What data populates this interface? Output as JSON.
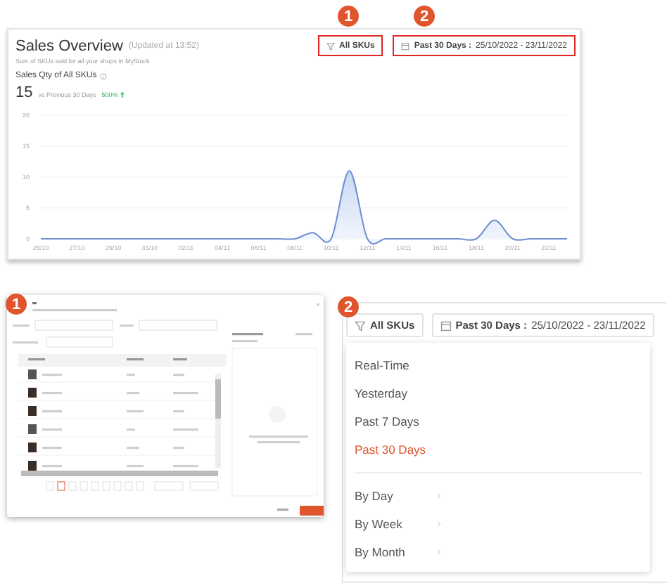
{
  "overview": {
    "badges": [
      {
        "label": "1"
      },
      {
        "label": "2"
      }
    ],
    "title": "Sales Overview",
    "updated": "(Updated at 13:52)",
    "subtitle": "Sum of SKUs sold for all your shops in MyStock",
    "filters": {
      "sku_button": "All SKUs",
      "date_label": "Past 30 Days :",
      "date_range": "25/10/2022 - 23/11/2022"
    },
    "metric_label": "Sales Qty of All SKUs",
    "value": "15",
    "compare_label": "vs Previous 30 Days",
    "change": "500%",
    "chart_data": {
      "type": "area",
      "categories": [
        "25/10",
        null,
        "27/10",
        null,
        "29/10",
        null,
        "31/10",
        null,
        "02/11",
        null,
        "04/11",
        null,
        "06/11",
        null,
        "08/11",
        null,
        "10/11",
        null,
        "12/11",
        null,
        "14/11",
        null,
        "16/11",
        null,
        "18/11",
        null,
        "20/11",
        null,
        "22/11",
        null
      ],
      "series": [
        {
          "color": "#6f8fd0",
          "values": [
            0,
            0,
            0,
            0,
            0,
            0,
            0,
            0,
            0,
            0,
            0,
            0,
            0,
            0,
            0,
            1,
            0,
            11,
            0,
            0,
            0,
            0,
            0,
            0,
            0,
            3,
            0,
            0,
            0,
            0
          ]
        }
      ],
      "ylim": [
        0,
        20
      ],
      "yticks": [
        0,
        5,
        10,
        15,
        20
      ],
      "grid": true
    }
  },
  "dialog": {
    "badge": "1"
  },
  "dropdown": {
    "badge": "2",
    "sku_button": "All SKUs",
    "date_label": "Past 30 Days :",
    "date_range": "25/10/2022 - 23/11/2022",
    "options": [
      {
        "kind": "preset",
        "label": "Real-Time",
        "selected": false
      },
      {
        "kind": "preset",
        "label": "Yesterday",
        "selected": false
      },
      {
        "kind": "preset",
        "label": "Past 7 Days",
        "selected": false
      },
      {
        "kind": "preset",
        "label": "Past 30 Days",
        "selected": true
      },
      {
        "kind": "submenu",
        "label": "By Day",
        "selected": false
      },
      {
        "kind": "submenu",
        "label": "By Week",
        "selected": false
      },
      {
        "kind": "submenu",
        "label": "By Month",
        "selected": false
      }
    ]
  }
}
